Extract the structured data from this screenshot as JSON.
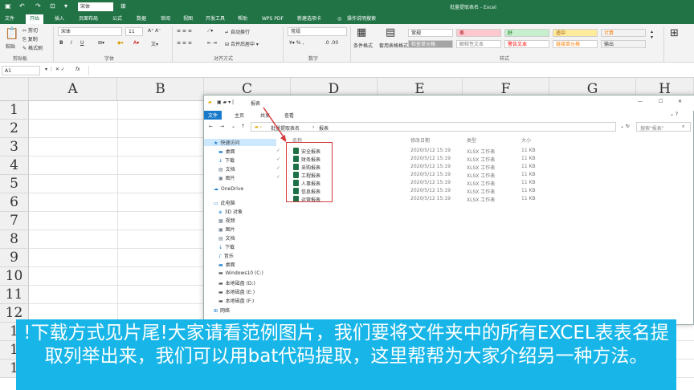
{
  "titlebar": {
    "font_box": "宋体",
    "window_title": "批量提取表名 - Excel"
  },
  "menu_tabs": [
    "文件",
    "开始",
    "插入",
    "页面布局",
    "公式",
    "数据",
    "审阅",
    "视图",
    "开发工具",
    "帮助",
    "WPS PDF",
    "新建选项卡",
    "操作说明搜索"
  ],
  "ribbon": {
    "clipboard": {
      "paste": "粘贴",
      "cut": "剪切",
      "copy": "复制",
      "format_painter": "格式刷",
      "group": "剪贴板"
    },
    "font": {
      "name": "宋体",
      "size": "11",
      "bold": "B",
      "italic": "I",
      "underline": "U",
      "group": "字体"
    },
    "alignment": {
      "wrap": "自动换行",
      "merge": "合并后居中",
      "group": "对齐方式"
    },
    "number": {
      "format": "常规",
      "group": "数字"
    },
    "styles": {
      "conditional": "条件格式",
      "table": "套用表格格式",
      "cells": [
        {
          "label": "常规",
          "bg": "#ffffff",
          "fg": "#222222"
        },
        {
          "label": "差",
          "bg": "#ffc7ce",
          "fg": "#9c0006"
        },
        {
          "label": "好",
          "bg": "#c6efce",
          "fg": "#006100"
        },
        {
          "label": "适中",
          "bg": "#ffeb9c",
          "fg": "#9c5700"
        },
        {
          "label": "计算",
          "bg": "#f2f2f2",
          "fg": "#fa7d00"
        },
        {
          "label": "检查单元格",
          "bg": "#a5a5a5",
          "fg": "#ffffff"
        },
        {
          "label": "解释性文本",
          "bg": "#ffffff",
          "fg": "#7f7f7f"
        },
        {
          "label": "警告文本",
          "bg": "#ffffff",
          "fg": "#ff0000"
        },
        {
          "label": "链接单元格",
          "bg": "#ffffff",
          "fg": "#fa7d00"
        },
        {
          "label": "输出",
          "bg": "#f2f2f2",
          "fg": "#3f3f3f"
        }
      ],
      "group": "样式"
    },
    "clipboard_group": "剪贴板"
  },
  "formula_bar": {
    "name_box": "A1",
    "fx": "fx"
  },
  "columns": [
    "A",
    "B",
    "C",
    "D",
    "E",
    "F",
    "G",
    "H"
  ],
  "rows": [
    "1",
    "2",
    "3",
    "4",
    "5",
    "6",
    "7",
    "8",
    "9",
    "10",
    "11",
    "12",
    "1",
    "1",
    "1"
  ],
  "explorer": {
    "title": "报表",
    "menu": [
      "文件",
      "主页",
      "共享",
      "查看"
    ],
    "path": [
      "批量提取表名",
      "报表"
    ],
    "search_placeholder": "搜索\"报表\"",
    "nav": [
      {
        "label": "快速访问",
        "icon": "star-icon"
      },
      {
        "label": "桌面",
        "icon": "desktop-icon"
      },
      {
        "label": "下载",
        "icon": "download-icon"
      },
      {
        "label": "文档",
        "icon": "document-icon"
      },
      {
        "label": "图片",
        "icon": "picture-icon"
      },
      {
        "label": "OneDrive",
        "icon": "cloud-icon"
      },
      {
        "label": "此电脑",
        "icon": "computer-icon"
      },
      {
        "label": "3D 对象",
        "icon": "cube-icon"
      },
      {
        "label": "视频",
        "icon": "video-icon"
      },
      {
        "label": "图片",
        "icon": "picture-icon"
      },
      {
        "label": "文档",
        "icon": "document-icon"
      },
      {
        "label": "下载",
        "icon": "download-icon"
      },
      {
        "label": "音乐",
        "icon": "music-icon"
      },
      {
        "label": "桌面",
        "icon": "desktop-icon"
      },
      {
        "label": "Windows10 (C:)",
        "icon": "drive-icon"
      },
      {
        "label": "本地磁盘 (D:)",
        "icon": "drive-icon"
      },
      {
        "label": "本地磁盘 (E:)",
        "icon": "drive-icon"
      },
      {
        "label": "本地磁盘 (F:)",
        "icon": "drive-icon"
      },
      {
        "label": "网络",
        "icon": "network-icon"
      }
    ],
    "headers": {
      "name": "名称",
      "date": "修改日期",
      "type": "类型",
      "size": "大小"
    },
    "files": [
      {
        "name": "安全报表",
        "date": "2020/5/12 15:19",
        "type": "XLSX 工作表",
        "size": "11 KB"
      },
      {
        "name": "财务报表",
        "date": "2020/5/12 15:19",
        "type": "XLSX 工作表",
        "size": "11 KB"
      },
      {
        "name": "采购报表",
        "date": "2020/5/12 15:19",
        "type": "XLSX 工作表",
        "size": "11 KB"
      },
      {
        "name": "工程报表",
        "date": "2020/5/12 15:19",
        "type": "XLSX 工作表",
        "size": "11 KB"
      },
      {
        "name": "人事报表",
        "date": "2020/5/12 15:19",
        "type": "XLSX 工作表",
        "size": "11 KB"
      },
      {
        "name": "信息报表",
        "date": "2020/5/12 15:19",
        "type": "XLSX 工作表",
        "size": "11 KB"
      },
      {
        "name": "运营报表",
        "date": "2020/5/12 15:19",
        "type": "XLSX 工作表",
        "size": "11 KB"
      }
    ]
  },
  "subtitle": "!下载方式见片尾!大家请看范例图片，我们要将文件夹中的所有EXCEL表表名提取列举出来，我们可以用bat代码提取，这里帮帮为大家介绍另一种方法。",
  "colors": {
    "excel_green": "#217346",
    "highlight_red": "#d43b3b",
    "subtitle_bg": "#18b6e8"
  }
}
